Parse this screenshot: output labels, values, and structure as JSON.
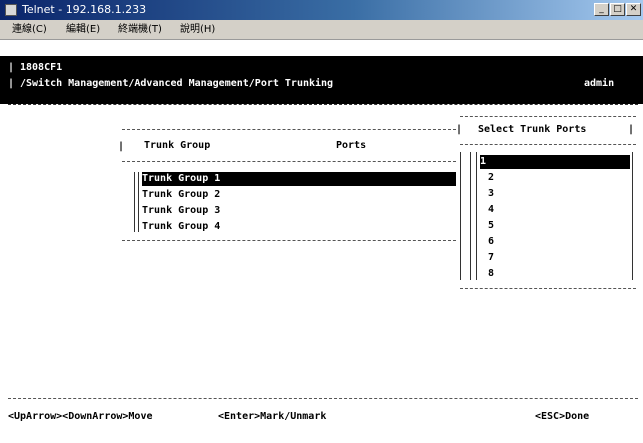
{
  "window": {
    "title": "Telnet - 192.168.1.233"
  },
  "menu": {
    "items": [
      "連線(C)",
      "編輯(E)",
      "終端機(T)",
      "說明(H)"
    ]
  },
  "header": {
    "device": "1808CF1",
    "path": "/Switch Management/Advanced Management/Port Trunking",
    "user": "admin"
  },
  "trunk_table": {
    "col_group": "Trunk Group",
    "col_ports": "Ports",
    "rows": [
      "Trunk Group 1",
      "Trunk Group 2",
      "Trunk Group 3",
      "Trunk Group 4"
    ],
    "selected_index": 0
  },
  "port_panel": {
    "title": "Select Trunk Ports",
    "ports": [
      "1",
      "2",
      "3",
      "4",
      "5",
      "6",
      "7",
      "8"
    ],
    "selected_index": 0
  },
  "footer": {
    "nav_hint": "<UpArrow><DownArrow>Move",
    "enter_hint": "<Enter>Mark/Unmark",
    "esc_hint": "<ESC>Done"
  }
}
